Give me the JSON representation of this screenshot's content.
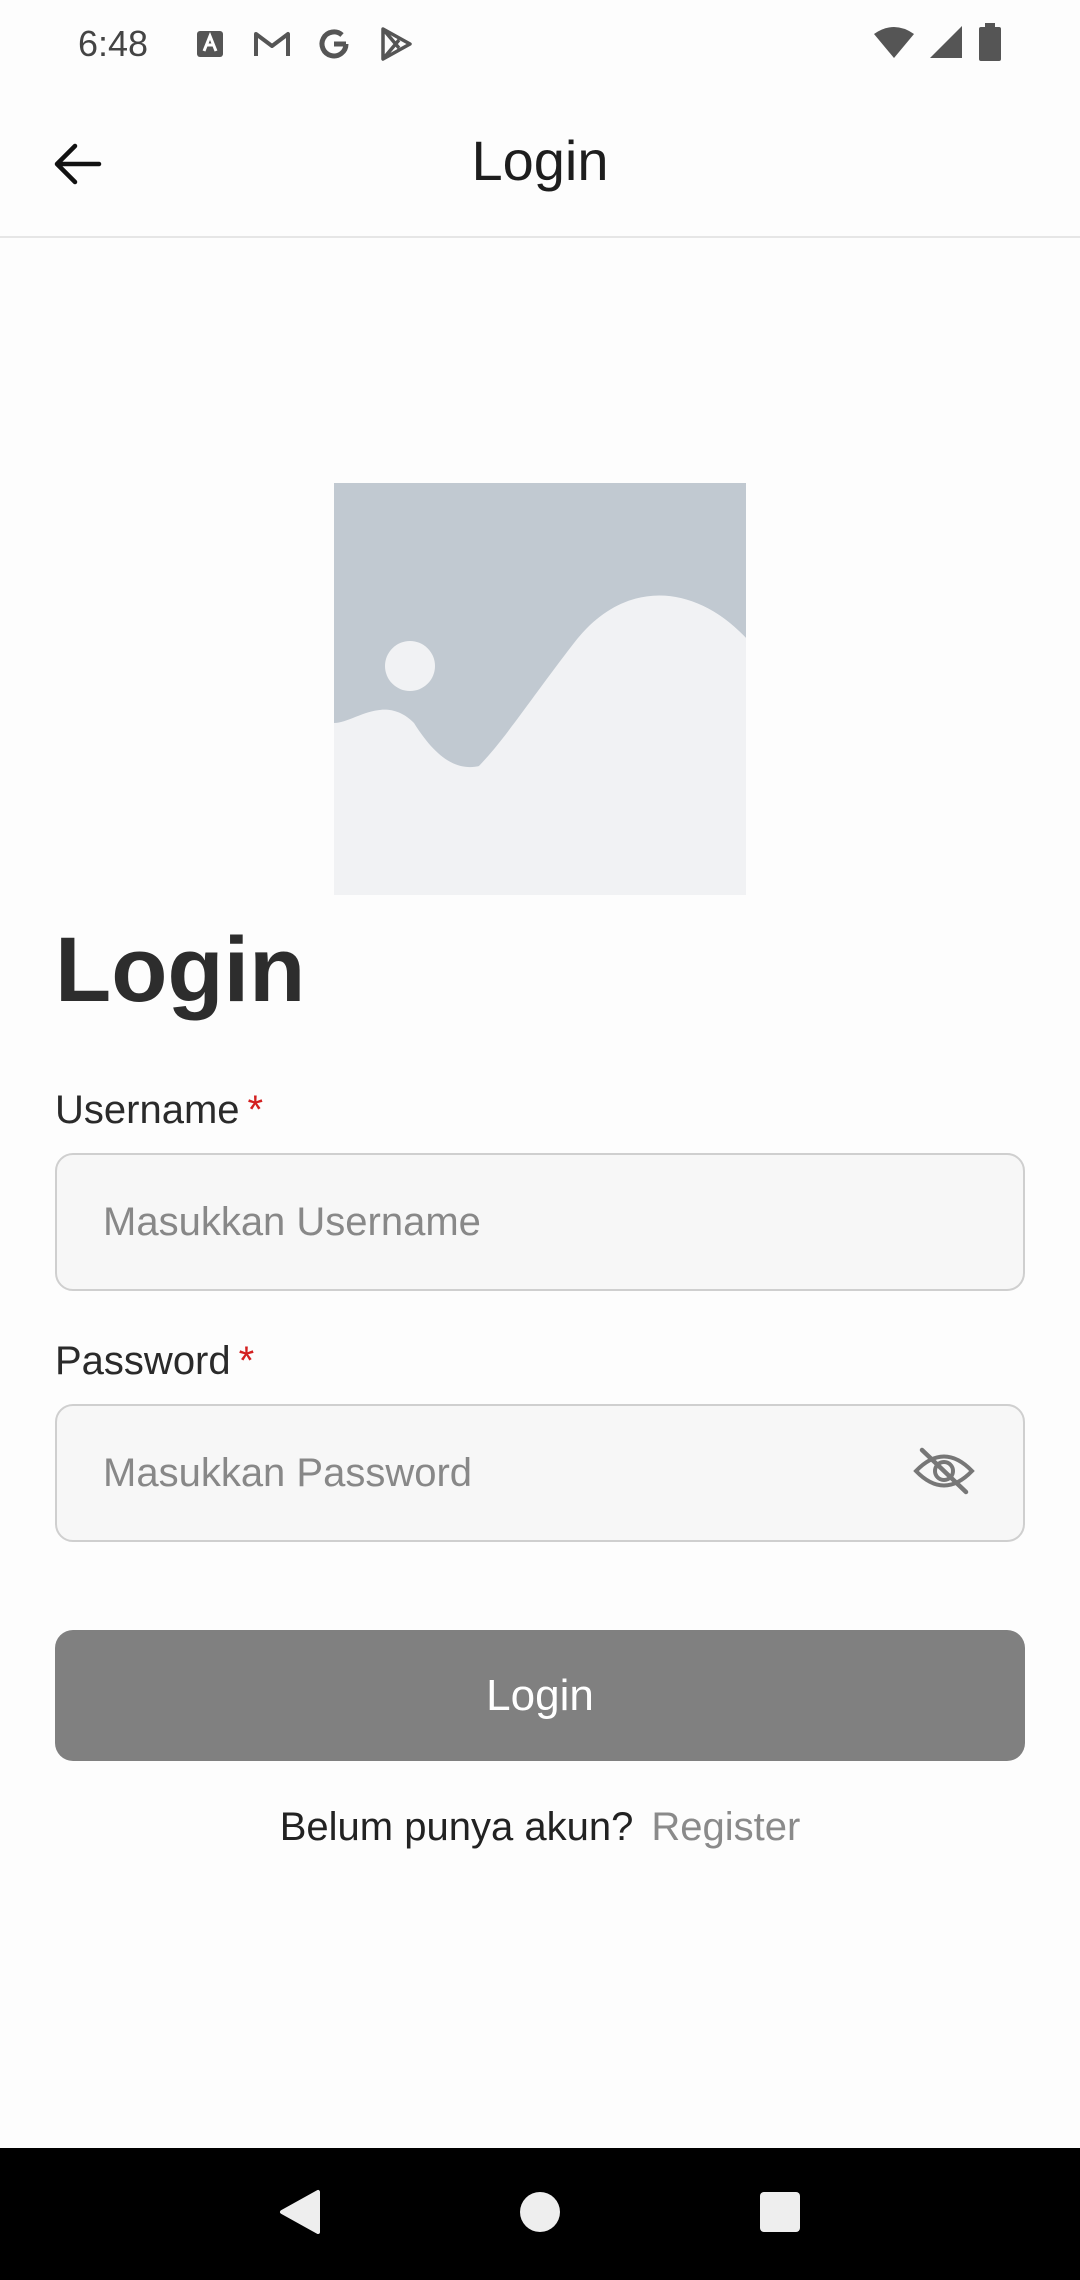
{
  "status_bar": {
    "time": "6:48",
    "left_icons": [
      "font-icon",
      "gmail-icon",
      "google-icon",
      "play-store-icon"
    ],
    "right_icons": [
      "wifi-icon",
      "signal-icon",
      "battery-icon"
    ]
  },
  "app_bar": {
    "title": "Login",
    "back_icon": "arrow-left-icon"
  },
  "heading": "Login",
  "form": {
    "username": {
      "label": "Username",
      "required_mark": "*",
      "placeholder": "Masukkan Username",
      "value": ""
    },
    "password": {
      "label": "Password",
      "required_mark": "*",
      "placeholder": "Masukkan Password",
      "value": "",
      "toggle_icon": "eye-off-icon"
    },
    "submit_label": "Login"
  },
  "register": {
    "prompt": "Belum punya akun?",
    "link": "Register"
  },
  "nav": {
    "back": "nav-back-icon",
    "home": "nav-home-icon",
    "recents": "nav-recents-icon"
  },
  "colors": {
    "button_disabled": "#808080",
    "required": "#d32020",
    "link_muted": "#8a8a8a",
    "image_placeholder": "#c1c9d1"
  }
}
